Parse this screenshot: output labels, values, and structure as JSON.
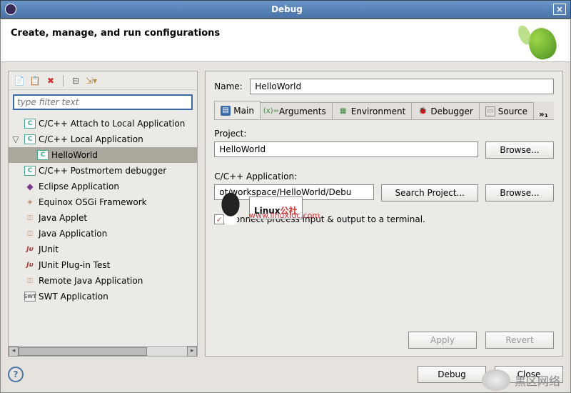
{
  "window": {
    "title": "Debug"
  },
  "header": {
    "subtitle": "Create, manage, and run configurations"
  },
  "filter": {
    "placeholder": "type filter text"
  },
  "tree": [
    {
      "label": "C/C++ Attach to Local Application",
      "icon": "c",
      "level": 1
    },
    {
      "label": "C/C++ Local Application",
      "icon": "c",
      "level": 1,
      "expanded": true
    },
    {
      "label": "HelloWorld",
      "icon": "c",
      "level": 2,
      "selected": true
    },
    {
      "label": "C/C++ Postmortem debugger",
      "icon": "c",
      "level": 1
    },
    {
      "label": "Eclipse Application",
      "icon": "ec",
      "level": 1
    },
    {
      "label": "Equinox OSGi Framework",
      "icon": "eq",
      "level": 1
    },
    {
      "label": "Java Applet",
      "icon": "ja",
      "level": 1
    },
    {
      "label": "Java Application",
      "icon": "ja",
      "level": 1
    },
    {
      "label": "JUnit",
      "icon": "jt",
      "level": 1
    },
    {
      "label": "JUnit Plug-in Test",
      "icon": "jt",
      "level": 1
    },
    {
      "label": "Remote Java Application",
      "icon": "ja",
      "level": 1
    },
    {
      "label": "SWT Application",
      "icon": "swt",
      "level": 1
    }
  ],
  "form": {
    "name_label": "Name:",
    "name_value": "HelloWorld",
    "project_label": "Project:",
    "project_value": "HelloWorld",
    "app_label": "C/C++ Application:",
    "app_value": "ot/workspace/HelloWorld/Debu",
    "browse": "Browse...",
    "search_project": "Search Project...",
    "checkbox_label": "Connect process input & output to a terminal.",
    "checkbox_checked": true
  },
  "tabs": [
    {
      "label": "Main",
      "icon": "main",
      "active": true
    },
    {
      "label": "Arguments",
      "icon": "arg"
    },
    {
      "label": "Environment",
      "icon": "env"
    },
    {
      "label": "Debugger",
      "icon": "dbg"
    },
    {
      "label": "Source",
      "icon": "src"
    }
  ],
  "tabs_more": "»₁",
  "buttons": {
    "apply": "Apply",
    "revert": "Revert",
    "debug": "Debug",
    "close": "Close"
  },
  "watermark": {
    "brand": "Linux",
    "suffix": "公社",
    "url": "www.linuxidc.com"
  },
  "corner_brand": "黑区网络"
}
